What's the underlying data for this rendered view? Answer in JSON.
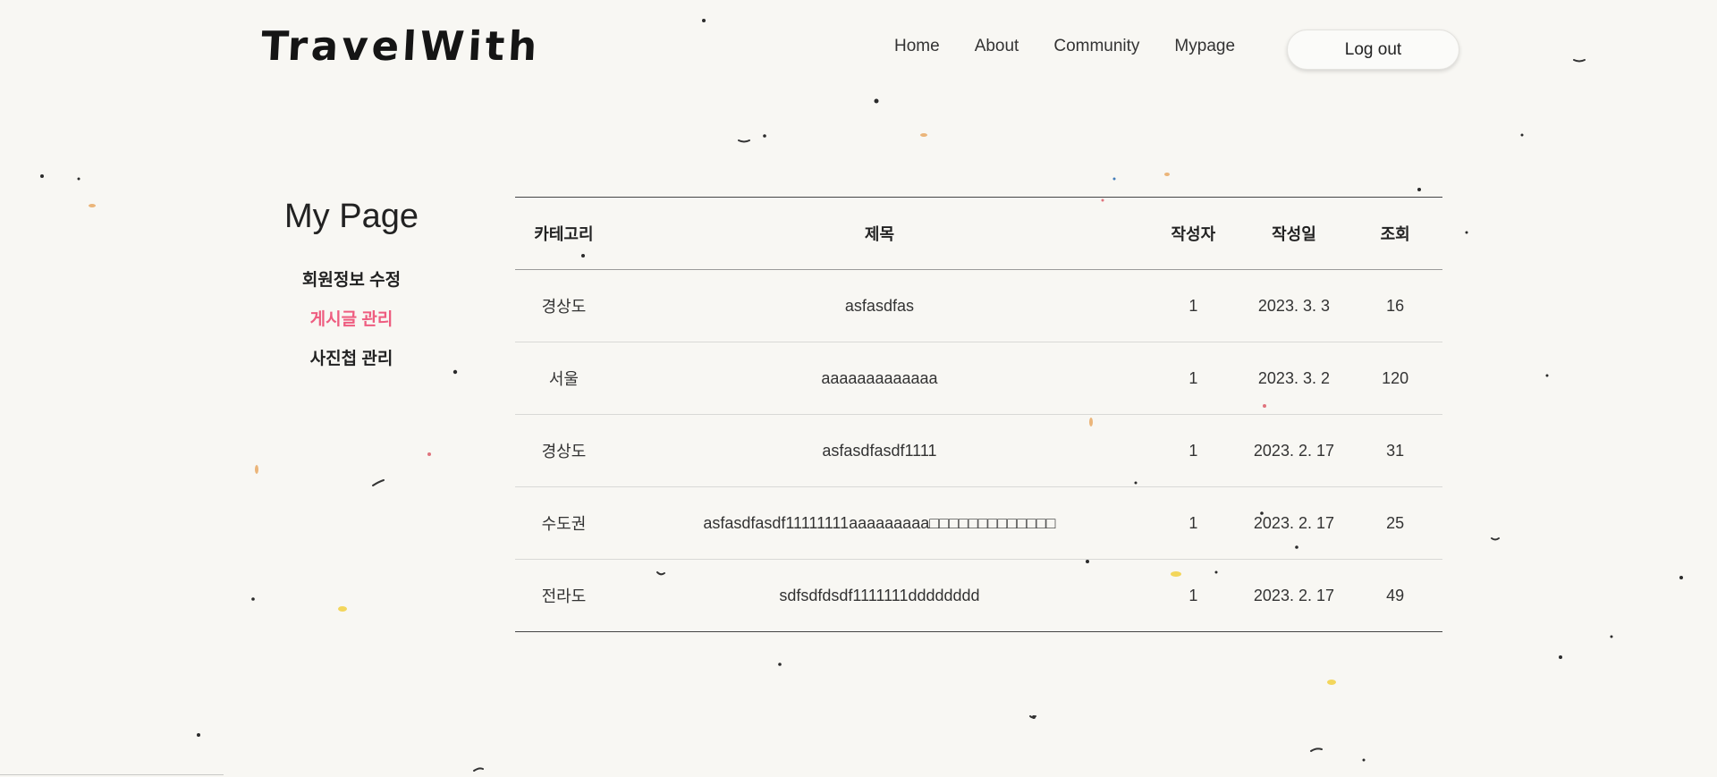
{
  "header": {
    "logo": "TravelWith",
    "nav": [
      "Home",
      "About",
      "Community",
      "Mypage"
    ],
    "logout_label": "Log out"
  },
  "sidebar": {
    "title": "My Page",
    "items": [
      {
        "label": "회원정보 수정",
        "active": false
      },
      {
        "label": "게시글 관리",
        "active": true
      },
      {
        "label": "사진첩 관리",
        "active": false
      }
    ]
  },
  "table": {
    "columns": [
      "카테고리",
      "제목",
      "작성자",
      "작성일",
      "조회"
    ],
    "rows": [
      {
        "category": "경상도",
        "title": "asfasdfas",
        "author": "1",
        "date": "2023. 3. 3",
        "views": "16"
      },
      {
        "category": "서울",
        "title": "aaaaaaaaaaaaa",
        "author": "1",
        "date": "2023. 3. 2",
        "views": "120"
      },
      {
        "category": "경상도",
        "title": "asfasdfasdf1111",
        "author": "1",
        "date": "2023. 2. 17",
        "views": "31"
      },
      {
        "category": "수도권",
        "title": "asfasdfasdf11111111aaaaaaaaa□□□□□□□□□□□□□",
        "author": "1",
        "date": "2023. 2. 17",
        "views": "25"
      },
      {
        "category": "전라도",
        "title": "sdfsdfdsdf1111111dddddddd",
        "author": "1",
        "date": "2023. 2. 17",
        "views": "49"
      }
    ]
  },
  "colors": {
    "background": "#f8f7f3",
    "accent": "#ee5d80",
    "text": "#222222"
  }
}
